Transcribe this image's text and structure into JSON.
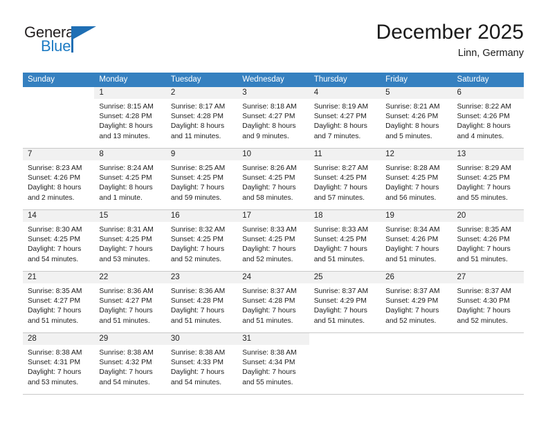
{
  "brand": {
    "name_part1": "General",
    "name_part2": "Blue",
    "accent_color": "#1f6fb4",
    "logo_icon": "triangle-flag-icon"
  },
  "header": {
    "month_title": "December 2025",
    "location": "Linn, Germany"
  },
  "calendar": {
    "header_color": "#3580c0",
    "weekdays": [
      "Sunday",
      "Monday",
      "Tuesday",
      "Wednesday",
      "Thursday",
      "Friday",
      "Saturday"
    ],
    "weeks": [
      [
        {
          "day": "",
          "lines": []
        },
        {
          "day": "1",
          "lines": [
            "Sunrise: 8:15 AM",
            "Sunset: 4:28 PM",
            "Daylight: 8 hours",
            "and 13 minutes."
          ]
        },
        {
          "day": "2",
          "lines": [
            "Sunrise: 8:17 AM",
            "Sunset: 4:28 PM",
            "Daylight: 8 hours",
            "and 11 minutes."
          ]
        },
        {
          "day": "3",
          "lines": [
            "Sunrise: 8:18 AM",
            "Sunset: 4:27 PM",
            "Daylight: 8 hours",
            "and 9 minutes."
          ]
        },
        {
          "day": "4",
          "lines": [
            "Sunrise: 8:19 AM",
            "Sunset: 4:27 PM",
            "Daylight: 8 hours",
            "and 7 minutes."
          ]
        },
        {
          "day": "5",
          "lines": [
            "Sunrise: 8:21 AM",
            "Sunset: 4:26 PM",
            "Daylight: 8 hours",
            "and 5 minutes."
          ]
        },
        {
          "day": "6",
          "lines": [
            "Sunrise: 8:22 AM",
            "Sunset: 4:26 PM",
            "Daylight: 8 hours",
            "and 4 minutes."
          ]
        }
      ],
      [
        {
          "day": "7",
          "lines": [
            "Sunrise: 8:23 AM",
            "Sunset: 4:26 PM",
            "Daylight: 8 hours",
            "and 2 minutes."
          ]
        },
        {
          "day": "8",
          "lines": [
            "Sunrise: 8:24 AM",
            "Sunset: 4:25 PM",
            "Daylight: 8 hours",
            "and 1 minute."
          ]
        },
        {
          "day": "9",
          "lines": [
            "Sunrise: 8:25 AM",
            "Sunset: 4:25 PM",
            "Daylight: 7 hours",
            "and 59 minutes."
          ]
        },
        {
          "day": "10",
          "lines": [
            "Sunrise: 8:26 AM",
            "Sunset: 4:25 PM",
            "Daylight: 7 hours",
            "and 58 minutes."
          ]
        },
        {
          "day": "11",
          "lines": [
            "Sunrise: 8:27 AM",
            "Sunset: 4:25 PM",
            "Daylight: 7 hours",
            "and 57 minutes."
          ]
        },
        {
          "day": "12",
          "lines": [
            "Sunrise: 8:28 AM",
            "Sunset: 4:25 PM",
            "Daylight: 7 hours",
            "and 56 minutes."
          ]
        },
        {
          "day": "13",
          "lines": [
            "Sunrise: 8:29 AM",
            "Sunset: 4:25 PM",
            "Daylight: 7 hours",
            "and 55 minutes."
          ]
        }
      ],
      [
        {
          "day": "14",
          "lines": [
            "Sunrise: 8:30 AM",
            "Sunset: 4:25 PM",
            "Daylight: 7 hours",
            "and 54 minutes."
          ]
        },
        {
          "day": "15",
          "lines": [
            "Sunrise: 8:31 AM",
            "Sunset: 4:25 PM",
            "Daylight: 7 hours",
            "and 53 minutes."
          ]
        },
        {
          "day": "16",
          "lines": [
            "Sunrise: 8:32 AM",
            "Sunset: 4:25 PM",
            "Daylight: 7 hours",
            "and 52 minutes."
          ]
        },
        {
          "day": "17",
          "lines": [
            "Sunrise: 8:33 AM",
            "Sunset: 4:25 PM",
            "Daylight: 7 hours",
            "and 52 minutes."
          ]
        },
        {
          "day": "18",
          "lines": [
            "Sunrise: 8:33 AM",
            "Sunset: 4:25 PM",
            "Daylight: 7 hours",
            "and 51 minutes."
          ]
        },
        {
          "day": "19",
          "lines": [
            "Sunrise: 8:34 AM",
            "Sunset: 4:26 PM",
            "Daylight: 7 hours",
            "and 51 minutes."
          ]
        },
        {
          "day": "20",
          "lines": [
            "Sunrise: 8:35 AM",
            "Sunset: 4:26 PM",
            "Daylight: 7 hours",
            "and 51 minutes."
          ]
        }
      ],
      [
        {
          "day": "21",
          "lines": [
            "Sunrise: 8:35 AM",
            "Sunset: 4:27 PM",
            "Daylight: 7 hours",
            "and 51 minutes."
          ]
        },
        {
          "day": "22",
          "lines": [
            "Sunrise: 8:36 AM",
            "Sunset: 4:27 PM",
            "Daylight: 7 hours",
            "and 51 minutes."
          ]
        },
        {
          "day": "23",
          "lines": [
            "Sunrise: 8:36 AM",
            "Sunset: 4:28 PM",
            "Daylight: 7 hours",
            "and 51 minutes."
          ]
        },
        {
          "day": "24",
          "lines": [
            "Sunrise: 8:37 AM",
            "Sunset: 4:28 PM",
            "Daylight: 7 hours",
            "and 51 minutes."
          ]
        },
        {
          "day": "25",
          "lines": [
            "Sunrise: 8:37 AM",
            "Sunset: 4:29 PM",
            "Daylight: 7 hours",
            "and 51 minutes."
          ]
        },
        {
          "day": "26",
          "lines": [
            "Sunrise: 8:37 AM",
            "Sunset: 4:29 PM",
            "Daylight: 7 hours",
            "and 52 minutes."
          ]
        },
        {
          "day": "27",
          "lines": [
            "Sunrise: 8:37 AM",
            "Sunset: 4:30 PM",
            "Daylight: 7 hours",
            "and 52 minutes."
          ]
        }
      ],
      [
        {
          "day": "28",
          "lines": [
            "Sunrise: 8:38 AM",
            "Sunset: 4:31 PM",
            "Daylight: 7 hours",
            "and 53 minutes."
          ]
        },
        {
          "day": "29",
          "lines": [
            "Sunrise: 8:38 AM",
            "Sunset: 4:32 PM",
            "Daylight: 7 hours",
            "and 54 minutes."
          ]
        },
        {
          "day": "30",
          "lines": [
            "Sunrise: 8:38 AM",
            "Sunset: 4:33 PM",
            "Daylight: 7 hours",
            "and 54 minutes."
          ]
        },
        {
          "day": "31",
          "lines": [
            "Sunrise: 8:38 AM",
            "Sunset: 4:34 PM",
            "Daylight: 7 hours",
            "and 55 minutes."
          ]
        },
        {
          "day": "",
          "lines": []
        },
        {
          "day": "",
          "lines": []
        },
        {
          "day": "",
          "lines": []
        }
      ]
    ]
  }
}
